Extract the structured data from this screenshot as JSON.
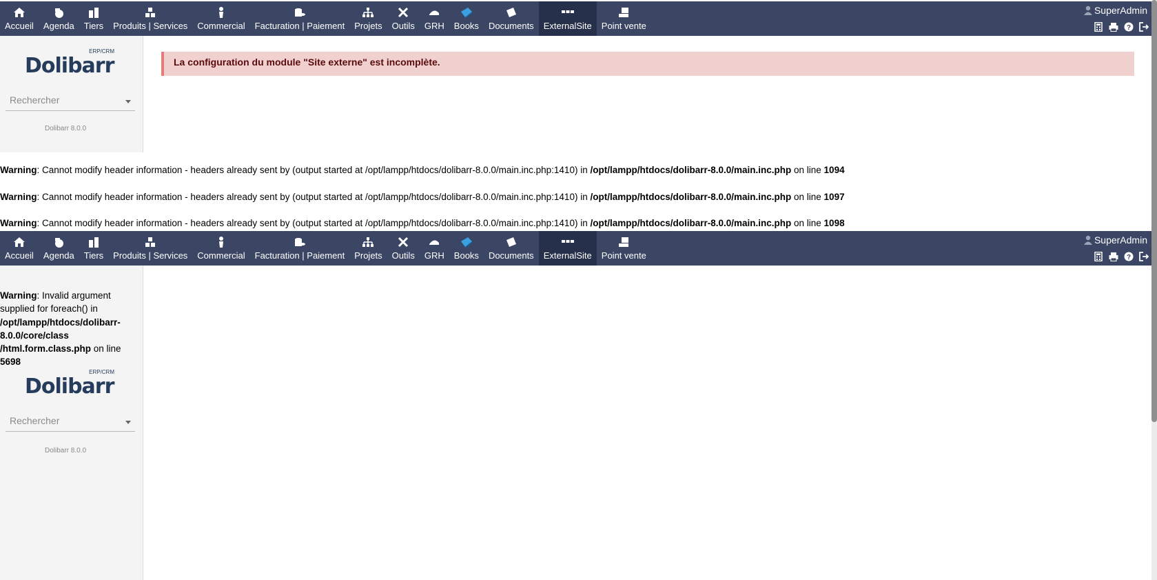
{
  "colors": {
    "topbar": "#3b4664",
    "topbar_active": "#26304a",
    "alert_bg": "#f1d0d0",
    "alert_border": "#e57b7b"
  },
  "menu": [
    {
      "label": "Accueil",
      "icon": "home-icon"
    },
    {
      "label": "Agenda",
      "icon": "agenda-icon"
    },
    {
      "label": "Tiers",
      "icon": "company-icon"
    },
    {
      "label": "Produits | Services",
      "icon": "products-icon"
    },
    {
      "label": "Commercial",
      "icon": "commercial-icon"
    },
    {
      "label": "Facturation | Paiement",
      "icon": "billing-icon"
    },
    {
      "label": "Projets",
      "icon": "projects-icon"
    },
    {
      "label": "Outils",
      "icon": "tools-icon"
    },
    {
      "label": "GRH",
      "icon": "hrm-icon"
    },
    {
      "label": "Books",
      "icon": "books-icon"
    },
    {
      "label": "Documents",
      "icon": "documents-icon"
    },
    {
      "label": "ExternalSite",
      "icon": "externalsite-icon",
      "active": true
    },
    {
      "label": "Point vente",
      "icon": "pos-icon"
    }
  ],
  "user": {
    "name": "SuperAdmin"
  },
  "toolbar_icons": [
    "calculator-icon",
    "print-icon",
    "help-icon",
    "logout-icon"
  ],
  "logo": {
    "word": "Dolibarr",
    "tagline": "ERP/CRM"
  },
  "search": {
    "placeholder": "Rechercher"
  },
  "version": "Dolibarr 8.0.0",
  "alert": {
    "message": "La configuration du module \"Site externe\" est incomplète."
  },
  "warnings": [
    {
      "label": "Warning",
      "text": ": Cannot modify header information - headers already sent by (output started at /opt/lampp/htdocs/dolibarr-8.0.0/main.inc.php:1410) in ",
      "file": "/opt/lampp/htdocs/dolibarr-8.0.0/main.inc.php",
      "online": " on line ",
      "line": "1094"
    },
    {
      "label": "Warning",
      "text": ": Cannot modify header information - headers already sent by (output started at /opt/lampp/htdocs/dolibarr-8.0.0/main.inc.php:1410) in ",
      "file": "/opt/lampp/htdocs/dolibarr-8.0.0/main.inc.php",
      "online": " on line ",
      "line": "1097"
    },
    {
      "label": "Warning",
      "text": ": Cannot modify header information - headers already sent by (output started at /opt/lampp/htdocs/dolibarr-8.0.0/main.inc.php:1410) in ",
      "file": "/opt/lampp/htdocs/dolibarr-8.0.0/main.inc.php",
      "online": " on line ",
      "line": "1098"
    }
  ],
  "foreach_warning": {
    "label": "Warning",
    "text": ": Invalid argument supplied for foreach() in ",
    "file": "/opt/lampp/htdocs/dolibarr-8.0.0/core/class /html.form.class.php",
    "online": " on line ",
    "line": "5698"
  }
}
